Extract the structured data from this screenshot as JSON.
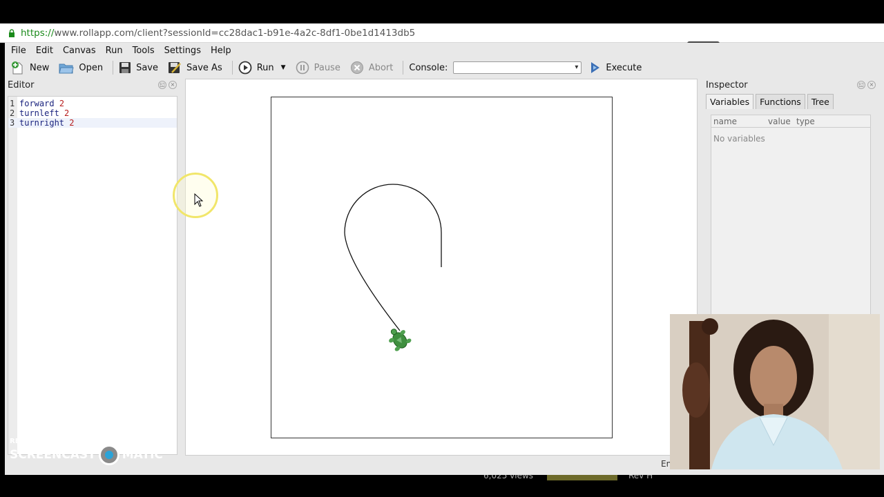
{
  "browser": {
    "url_scheme": "https://",
    "url_rest": "www.rollapp.com/client?sessionId=cc28dac1-b91e-4a2c-8df1-0be1d1413db5"
  },
  "menu": [
    "File",
    "Edit",
    "Canvas",
    "Run",
    "Tools",
    "Settings",
    "Help"
  ],
  "toolbar": {
    "new": "New",
    "open": "Open",
    "save": "Save",
    "save_as": "Save As",
    "run": "Run",
    "pause": "Pause",
    "abort": "Abort",
    "console_label": "Console:",
    "console_value": "",
    "execute": "Execute"
  },
  "editor": {
    "title": "Editor",
    "lines": [
      {
        "num": "1",
        "cmd": "forward",
        "arg": "2"
      },
      {
        "num": "2",
        "cmd": "turnleft",
        "arg": "2"
      },
      {
        "num": "3",
        "cmd": "turnright",
        "arg": "2"
      }
    ]
  },
  "inspector": {
    "title": "Inspector",
    "tabs": [
      "Variables",
      "Functions",
      "Tree"
    ],
    "active_tab": "Variables",
    "columns": [
      "name",
      "value",
      "type"
    ],
    "empty_text": "No variables"
  },
  "status": {
    "language": "En"
  },
  "bottom": {
    "views": "6,025 views",
    "name": "Rev H"
  },
  "watermark": {
    "recorded": "RECORDED WITH",
    "brand_left": "SCREENCAST",
    "brand_right": "MATIC"
  },
  "colors": {
    "turtle": "#3f8f3f",
    "trace": "#111111",
    "url_secure": "#1a8a1a",
    "cursor_highlight": "#f1e66a"
  }
}
